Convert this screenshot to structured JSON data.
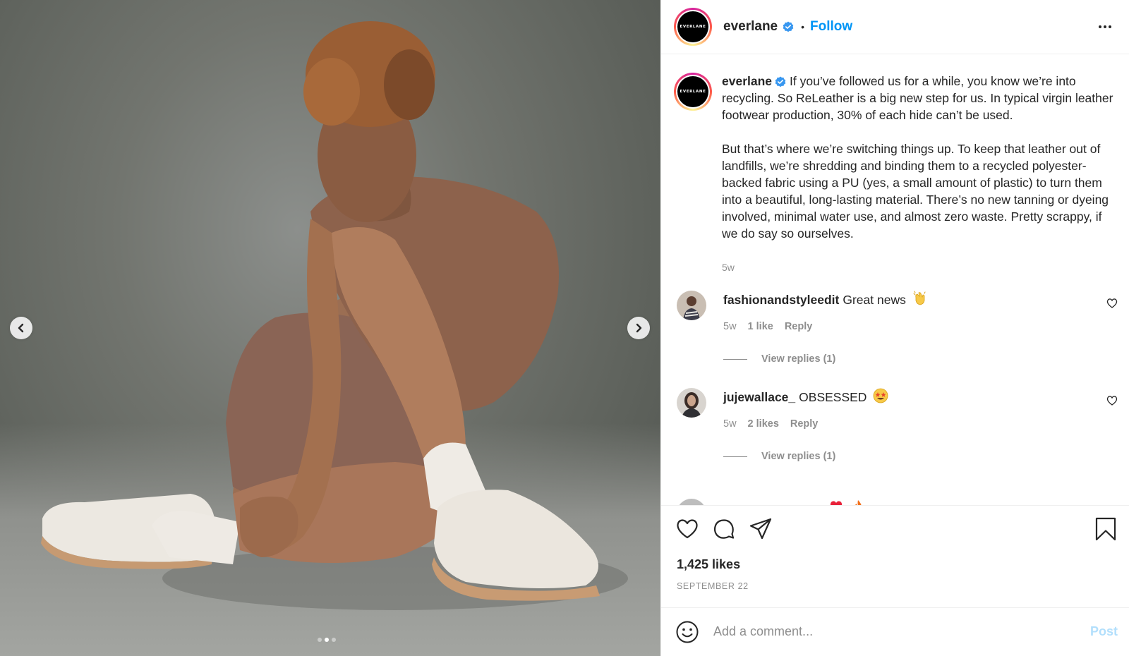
{
  "post": {
    "author": "everlane",
    "brand_logo_text": "EVERLANE",
    "follow_label": "Follow",
    "separator": "•",
    "caption_paragraph_1": "If you’ve followed us for a while, you know we’re into recycling. So ReLeather is a big new step for us. In typical virgin leather footwear production, 30% of each hide can’t be used.",
    "caption_paragraph_2": "But that’s where we’re switching things up. To keep that leather out of landfills, we’re shredding and binding them to a recycled polyester-backed fabric using a PU (yes, a small amount of plastic) to turn them into a beautiful, long-lasting material. There’s no new tanning or dyeing involved, minimal water use, and almost zero waste. Pretty scrappy, if we do say so ourselves.",
    "caption_time": "5w",
    "likes": "1,425 likes",
    "date": "SEPTEMBER 22",
    "carousel": {
      "slide_count": 3,
      "active_index": 1
    }
  },
  "comments": [
    {
      "username": "fashionandstyleedit",
      "text": "Great news",
      "emoji": "clapping-hands",
      "time": "5w",
      "likes": "1 like",
      "reply_label": "Reply",
      "view_replies": "View replies (1)"
    },
    {
      "username": "jujewallace_",
      "text": "OBSESSED",
      "emoji": "star-struck",
      "time": "5w",
      "likes": "2 likes",
      "reply_label": "Reply",
      "view_replies": "View replies (1)"
    }
  ],
  "add_comment": {
    "placeholder": "Add a comment...",
    "post_label": "Post"
  },
  "icons": {
    "verified": "verified-badge-icon",
    "more": "more-options-icon",
    "like": "heart-icon",
    "comment": "comment-icon",
    "share": "share-icon",
    "save": "bookmark-icon",
    "emoji_picker": "smiley-icon",
    "prev": "chevron-left-icon",
    "next": "chevron-right-icon"
  },
  "colors": {
    "accent_blue": "#0095f6",
    "post_disabled": "#b2dffc",
    "verified_blue": "#3897f0",
    "text": "#262626",
    "muted": "#8e8e8e"
  }
}
